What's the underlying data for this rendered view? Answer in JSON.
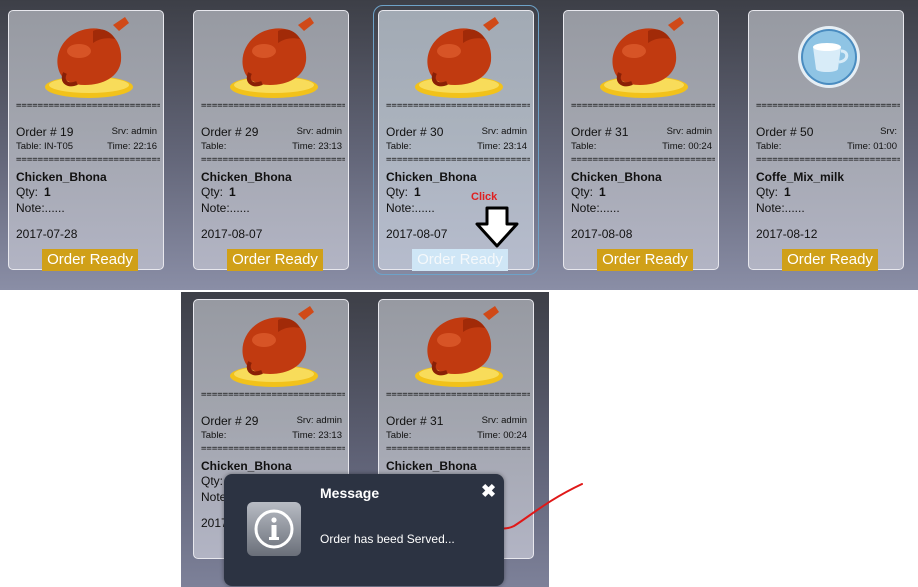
{
  "separator": "================================",
  "labels": {
    "order_prefix": "Order #",
    "srv_prefix": "Srv:",
    "table_prefix": "Table:",
    "time_prefix": "Time:",
    "qty_label": "Qty:",
    "note_label": "Note:......",
    "order_ready": "Order Ready"
  },
  "top_cards": [
    {
      "order": "19",
      "srv": "admin",
      "table": "IN-T05",
      "time": "22:16",
      "item": "Chicken_Bhona",
      "qty": "1",
      "date": "2017-07-28",
      "icon": "roast-chicken-icon"
    },
    {
      "order": "29",
      "srv": "admin",
      "table": "",
      "time": "23:13",
      "item": "Chicken_Bhona",
      "qty": "1",
      "date": "2017-08-07",
      "icon": "roast-chicken-icon"
    },
    {
      "order": "30",
      "srv": "admin",
      "table": "",
      "time": "23:14",
      "item": "Chicken_Bhona",
      "qty": "1",
      "date": "2017-08-07",
      "icon": "roast-chicken-icon"
    },
    {
      "order": "31",
      "srv": "admin",
      "table": "",
      "time": "00:24",
      "item": "Chicken_Bhona",
      "qty": "1",
      "date": "2017-08-08",
      "icon": "roast-chicken-icon"
    },
    {
      "order": "50",
      "srv": "",
      "table": "",
      "time": "01:00",
      "item": "Coffe_Mix_milk",
      "qty": "1",
      "date": "2017-08-12",
      "icon": "coffee-cup-icon"
    }
  ],
  "bottom_cards": [
    {
      "order": "29",
      "srv": "admin",
      "table": "",
      "time": "23:13",
      "item": "Chicken_Bhona",
      "qty": "Qty:",
      "note": "Note",
      "date": "2017",
      "icon": "roast-chicken-icon"
    },
    {
      "order": "31",
      "srv": "admin",
      "table": "",
      "time": "00:24",
      "item": "Chicken_Bhona",
      "icon": "roast-chicken-icon"
    }
  ],
  "annotation": {
    "click": "Click"
  },
  "dialog": {
    "title": "Message",
    "close": "✖",
    "message": "Order has beed Served...",
    "icon": "info-icon"
  }
}
